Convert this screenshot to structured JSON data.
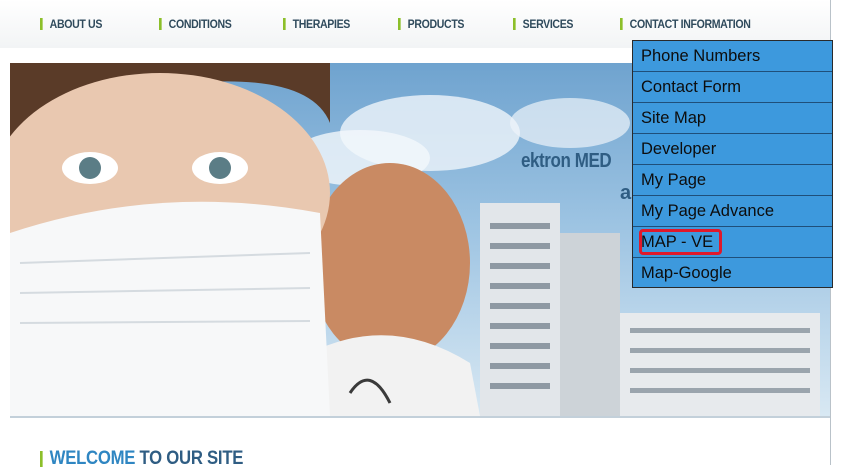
{
  "nav": {
    "items": [
      {
        "label": "ABOUT US"
      },
      {
        "label": "CONDITIONS"
      },
      {
        "label": "THERAPIES"
      },
      {
        "label": "PRODUCTS"
      },
      {
        "label": "SERVICES"
      },
      {
        "label": "CONTACT INFORMATION"
      }
    ],
    "accent_color": "#8cbf2a"
  },
  "dropdown": {
    "items": [
      {
        "label": "Phone Numbers"
      },
      {
        "label": "Contact Form"
      },
      {
        "label": "Site Map"
      },
      {
        "label": "Developer"
      },
      {
        "label": "My Page"
      },
      {
        "label": "My Page Advance"
      },
      {
        "label": "MAP - VE",
        "highlighted": true
      },
      {
        "label": "Map-Google"
      }
    ],
    "background_color": "#3d99dd",
    "highlight_color": "#e0192b"
  },
  "hero": {
    "text": "ektron MED",
    "subtext": "a"
  },
  "welcome": {
    "accent": "WELCOME",
    "rest": " TO OUR SITE"
  }
}
